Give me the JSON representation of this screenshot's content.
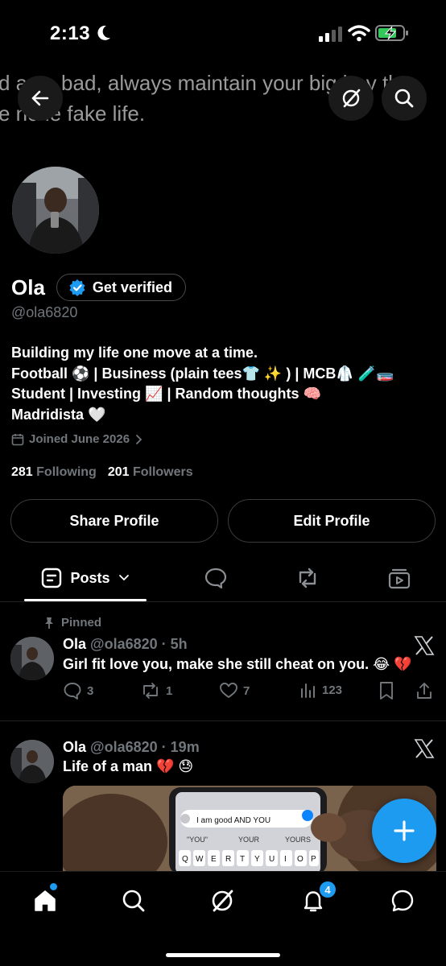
{
  "status_bar": {
    "time": "2:13"
  },
  "banner": {
    "line1": "d as a bad, always maintain your big boy tha",
    "line2": "e no le fake life."
  },
  "profile": {
    "name": "Ola",
    "verify_label": "Get verified",
    "handle": "@ola6820",
    "bio_lines": [
      "Building my life one move at a time.",
      "Football ⚽ | Business (plain tees👕 ✨ ) | MCB🥼 🧪🧫",
      "Student | Investing 📈 | Random thoughts 🧠",
      "Madridista 🤍"
    ],
    "joined": "Joined June 2026",
    "following_count": "281",
    "following_label": "Following",
    "followers_count": "201",
    "followers_label": "Followers"
  },
  "buttons": {
    "share": "Share Profile",
    "edit": "Edit Profile"
  },
  "tabs": {
    "posts": "Posts"
  },
  "posts": [
    {
      "pinned_label": "Pinned",
      "name": "Ola",
      "handle": "@ola6820",
      "time": "5h",
      "text": "Girl fit love you, make she still cheat on you. 😂 💔",
      "replies": "3",
      "reposts": "1",
      "likes": "7",
      "views": "123"
    },
    {
      "name": "Ola",
      "handle": "@ola6820",
      "time": "19m",
      "text": "Life of a man 💔 😓",
      "media": {
        "typed_text": "I am good AND YOU",
        "suggestions": [
          "\"YOU\"",
          "YOUR",
          "YOURS"
        ],
        "keys": [
          "Q",
          "W",
          "E",
          "R",
          "T",
          "Y",
          "U",
          "I",
          "O",
          "P"
        ]
      }
    }
  ],
  "nav": {
    "notif_count": "4"
  },
  "colors": {
    "accent": "#1d9bf0",
    "background": "#000000",
    "muted": "#71767b"
  }
}
